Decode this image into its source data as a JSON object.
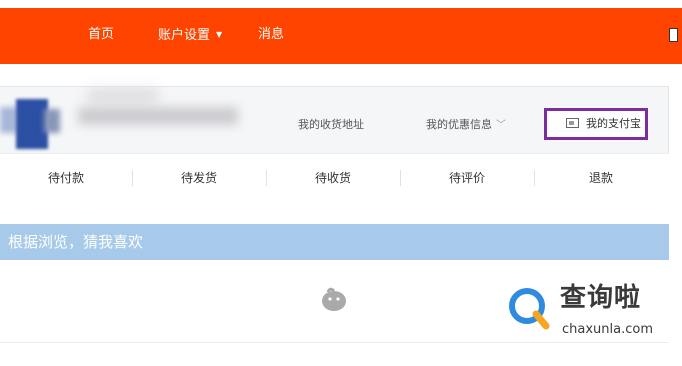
{
  "navbar": {
    "background": "#ff4400",
    "items": [
      "首页",
      "账户设置",
      "消息"
    ]
  },
  "profile": {
    "links": {
      "address": "我的收货地址",
      "coupons": "我的优惠信息",
      "alipay": "我的支付宝"
    },
    "highlight_color": "#7b2d9e"
  },
  "orders": {
    "tabs": [
      "待付款",
      "待发货",
      "待收货",
      "待评价",
      "退款"
    ]
  },
  "recommend": {
    "title": "根据浏览，猜我喜欢",
    "header_color": "#a7c9ea"
  },
  "watermark": {
    "text": "查询啦",
    "domain": "chaxunla.com"
  }
}
